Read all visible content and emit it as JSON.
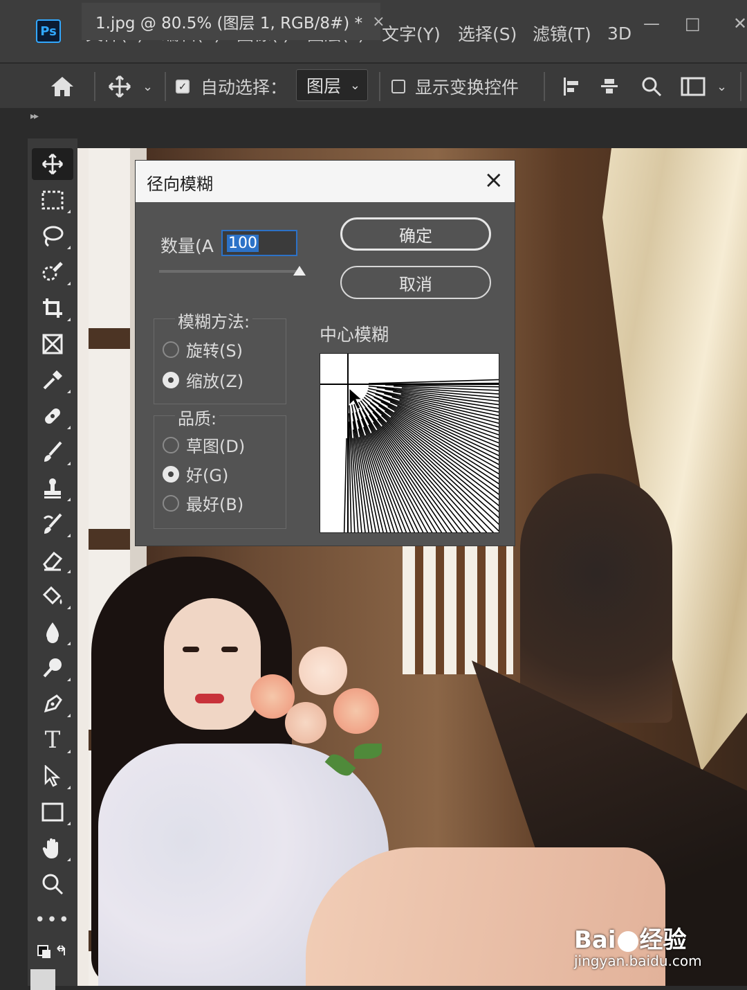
{
  "app": {
    "logo": "Ps"
  },
  "menu": [
    "文件(F)",
    "编辑(E)",
    "图像(I)",
    "图层(L)",
    "文字(Y)",
    "选择(S)",
    "滤镜(T)",
    "3D"
  ],
  "window_controls": {
    "minimize": "—",
    "restore": "□",
    "close": "✕"
  },
  "options_bar": {
    "auto_select_label": "自动选择：",
    "auto_select_checked": true,
    "auto_select_target": "图层",
    "show_transform_label": "显示变换控件",
    "show_transform_checked": false
  },
  "document_tab": {
    "title": "1.jpg @ 80.5% (图层 1, RGB/8#) *",
    "close": "×"
  },
  "tools": [
    "move-tool",
    "marquee-tool",
    "lasso-tool",
    "quick-select-tool",
    "crop-tool",
    "frame-tool",
    "eyedropper-tool",
    "healing-brush-tool",
    "brush-tool",
    "clone-stamp-tool",
    "history-brush-tool",
    "eraser-tool",
    "paint-bucket-tool",
    "blur-tool",
    "dodge-tool",
    "pen-tool",
    "type-tool",
    "path-select-tool",
    "rectangle-tool",
    "hand-tool",
    "zoom-tool",
    "more-tools",
    "swap-colors"
  ],
  "dialog": {
    "title": "径向模糊",
    "amount_label": "数量(A",
    "amount_value": "100",
    "amount_fraction": 1.0,
    "ok_label": "确定",
    "cancel_label": "取消",
    "method_title": "模糊方法:",
    "method_options": [
      {
        "label": "旋转(S)",
        "selected": false
      },
      {
        "label": "缩放(Z)",
        "selected": true
      }
    ],
    "quality_title": "品质:",
    "quality_options": [
      {
        "label": "草图(D)",
        "selected": false
      },
      {
        "label": "好(G)",
        "selected": true
      },
      {
        "label": "最好(B)",
        "selected": false
      }
    ],
    "center_label": "中心模糊"
  },
  "watermark": {
    "brand_left": "Bai",
    "brand_right": "经验",
    "url": "jingyan.baidu.com"
  },
  "colors": {
    "accent": "#2c72c7",
    "panel": "#535353",
    "menubar": "#3d3d3d"
  }
}
